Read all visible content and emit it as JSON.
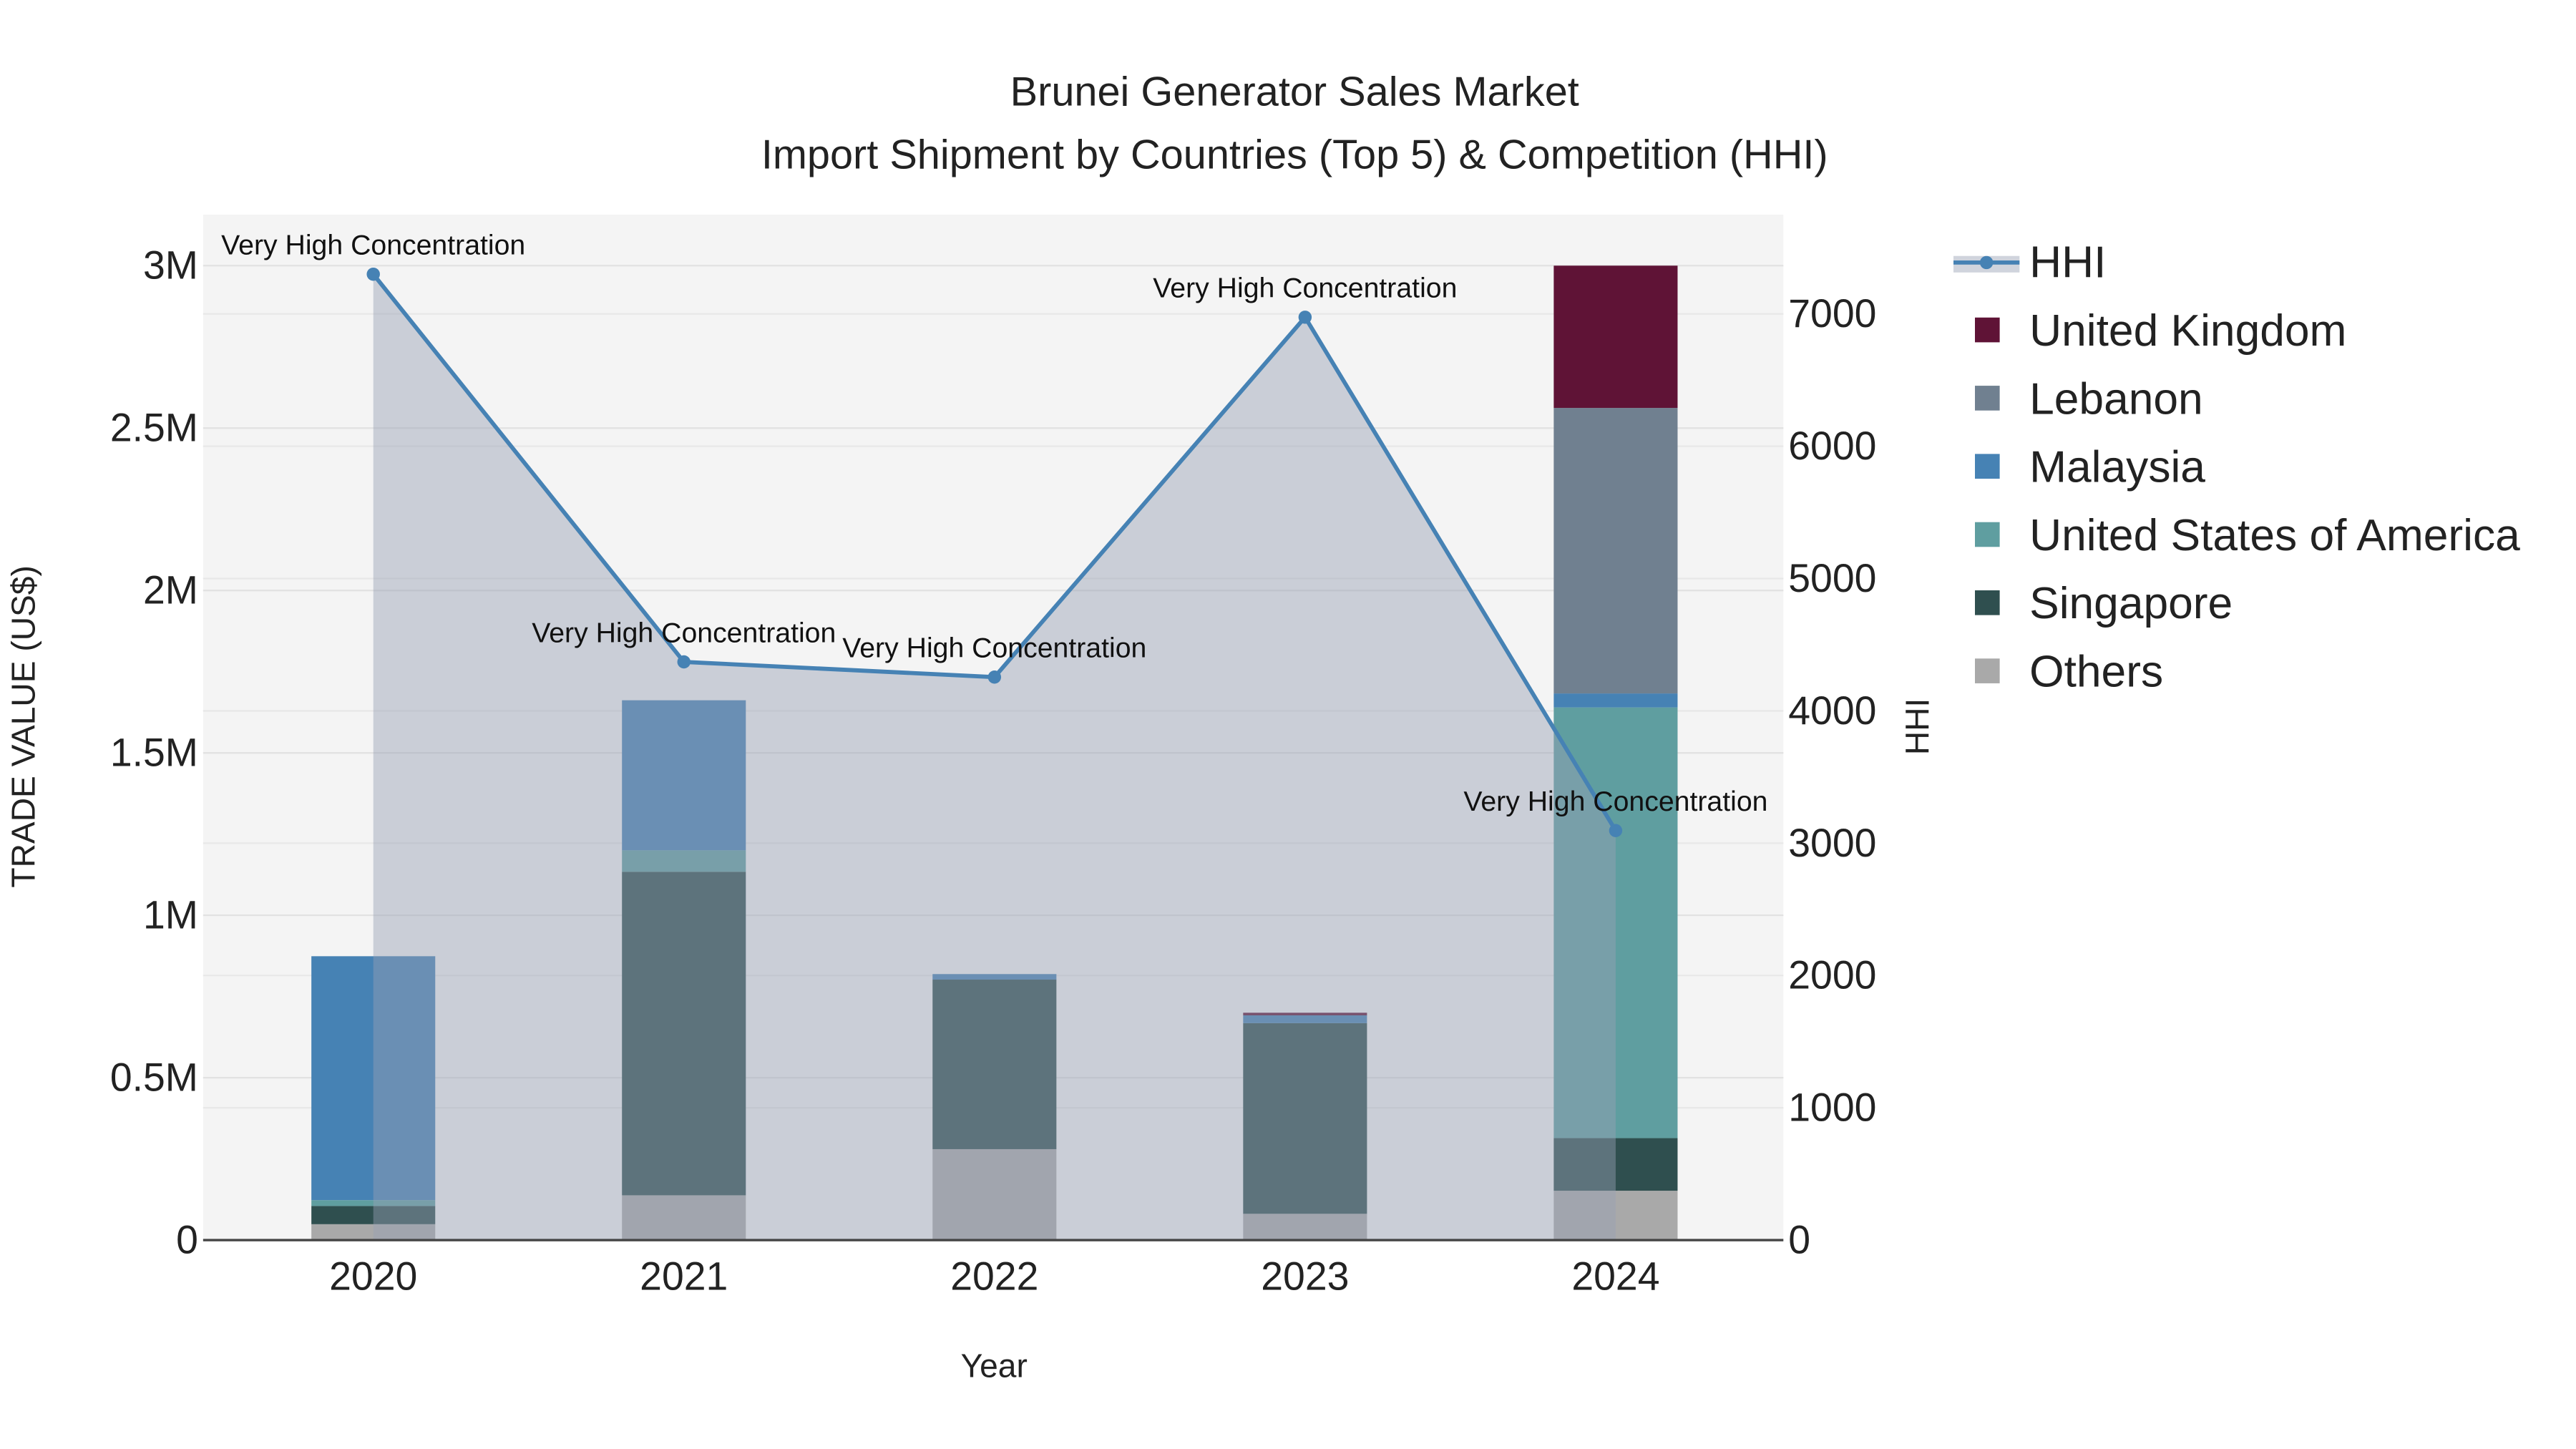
{
  "chart_data": {
    "type": "bar",
    "title_line1": "Brunei  Generator Sales Market",
    "title_line2": "Import Shipment by Countries (Top 5) & Competition (HHI)",
    "xlabel": "Year",
    "ylabel": "TRADE VALUE (US$)",
    "y2label": "HHI",
    "categories": [
      "2020",
      "2021",
      "2022",
      "2023",
      "2024"
    ],
    "ylim": [
      0,
      3157000
    ],
    "y2lim": [
      0,
      7750
    ],
    "yticks": [
      {
        "v": 0,
        "label": "0"
      },
      {
        "v": 500000,
        "label": "0.5M"
      },
      {
        "v": 1000000,
        "label": "1M"
      },
      {
        "v": 1500000,
        "label": "1.5M"
      },
      {
        "v": 2000000,
        "label": "2M"
      },
      {
        "v": 2500000,
        "label": "2.5M"
      },
      {
        "v": 3000000,
        "label": "3M"
      }
    ],
    "y2ticks": [
      {
        "v": 0,
        "label": "0"
      },
      {
        "v": 1000,
        "label": "1000"
      },
      {
        "v": 2000,
        "label": "2000"
      },
      {
        "v": 3000,
        "label": "3000"
      },
      {
        "v": 4000,
        "label": "4000"
      },
      {
        "v": 5000,
        "label": "5000"
      },
      {
        "v": 6000,
        "label": "6000"
      },
      {
        "v": 7000,
        "label": "7000"
      }
    ],
    "grid": true,
    "legend_position": "right",
    "series": [
      {
        "name": "Others",
        "color": "#a9a9a9",
        "values": [
          49000,
          138000,
          280000,
          81000,
          152000
        ]
      },
      {
        "name": "Singapore",
        "color": "#2f4f4f",
        "values": [
          56000,
          996000,
          522000,
          587000,
          162000
        ]
      },
      {
        "name": "United States of America",
        "color": "#5f9ea0",
        "values": [
          18000,
          66000,
          0,
          0,
          1326000
        ]
      },
      {
        "name": "Malaysia",
        "color": "#4682b4",
        "values": [
          751000,
          462000,
          17000,
          24000,
          43000
        ]
      },
      {
        "name": "Lebanon",
        "color": "#708090",
        "values": [
          0,
          0,
          0,
          0,
          879000
        ]
      },
      {
        "name": "United Kingdom",
        "color": "#5f1336",
        "values": [
          0,
          0,
          0,
          8000,
          438000
        ]
      }
    ],
    "hhi": {
      "name": "HHI",
      "color": "#4682b4",
      "values": [
        7300,
        4370,
        4255,
        6975,
        3095
      ],
      "annotations": [
        "Very High Concentration",
        "Very High Concentration",
        "Very High Concentration",
        "Very High Concentration",
        "Very High Concentration"
      ]
    },
    "legend_order": [
      "HHI",
      "United Kingdom",
      "Lebanon",
      "Malaysia",
      "United States of America",
      "Singapore",
      "Others"
    ]
  }
}
